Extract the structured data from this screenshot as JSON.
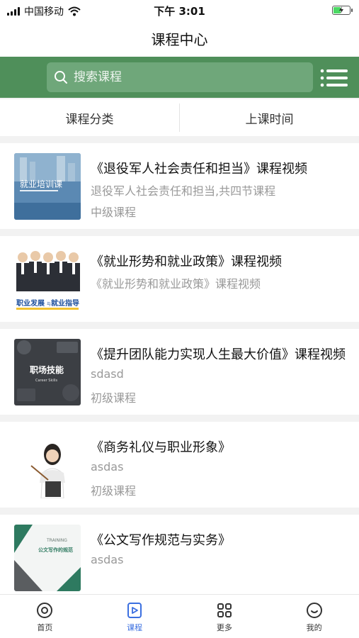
{
  "status_bar": {
    "carrier": "中国移动",
    "time": "下午 3:01"
  },
  "nav": {
    "title": "课程中心"
  },
  "search": {
    "placeholder": "搜索课程",
    "icon": "search-icon"
  },
  "filters": [
    {
      "label": "课程分类"
    },
    {
      "label": "上课时间"
    }
  ],
  "thumb_text": {
    "job_training": "就业培训课",
    "career_guide_a": "职业发展",
    "career_guide_small": "与",
    "career_guide_b": "就业指导",
    "workplace_skills": "职场技能",
    "workplace_skills_en": "Career Skills",
    "training": "TRAINING",
    "writing": "公文写作的规范"
  },
  "courses": [
    {
      "title": "《退役军人社会责任和担当》课程视频",
      "subtitle": "退役军人社会责任和担当,共四节课程",
      "level": "中级课程"
    },
    {
      "title": "《就业形势和就业政策》课程视频",
      "subtitle": "《就业形势和就业政策》课程视频",
      "level": ""
    },
    {
      "title": "《提升团队能力实现人生最大价值》课程视频",
      "subtitle": "sdasd",
      "level": "初级课程"
    },
    {
      "title": "《商务礼仪与职业形象》",
      "subtitle": "asdas",
      "level": "初级课程"
    },
    {
      "title": "《公文写作规范与实务》",
      "subtitle": "asdas",
      "level": ""
    }
  ],
  "tab_bar": {
    "items": [
      {
        "label": "首页",
        "icon": "home-icon"
      },
      {
        "label": "课程",
        "icon": "course-icon"
      },
      {
        "label": "更多",
        "icon": "more-grid-icon"
      },
      {
        "label": "我的",
        "icon": "profile-icon"
      }
    ],
    "active_index": 1
  },
  "colors": {
    "header_green": "#4f8f5a",
    "search_box": "#6fa77a",
    "active_tab": "#3b6fe0"
  }
}
